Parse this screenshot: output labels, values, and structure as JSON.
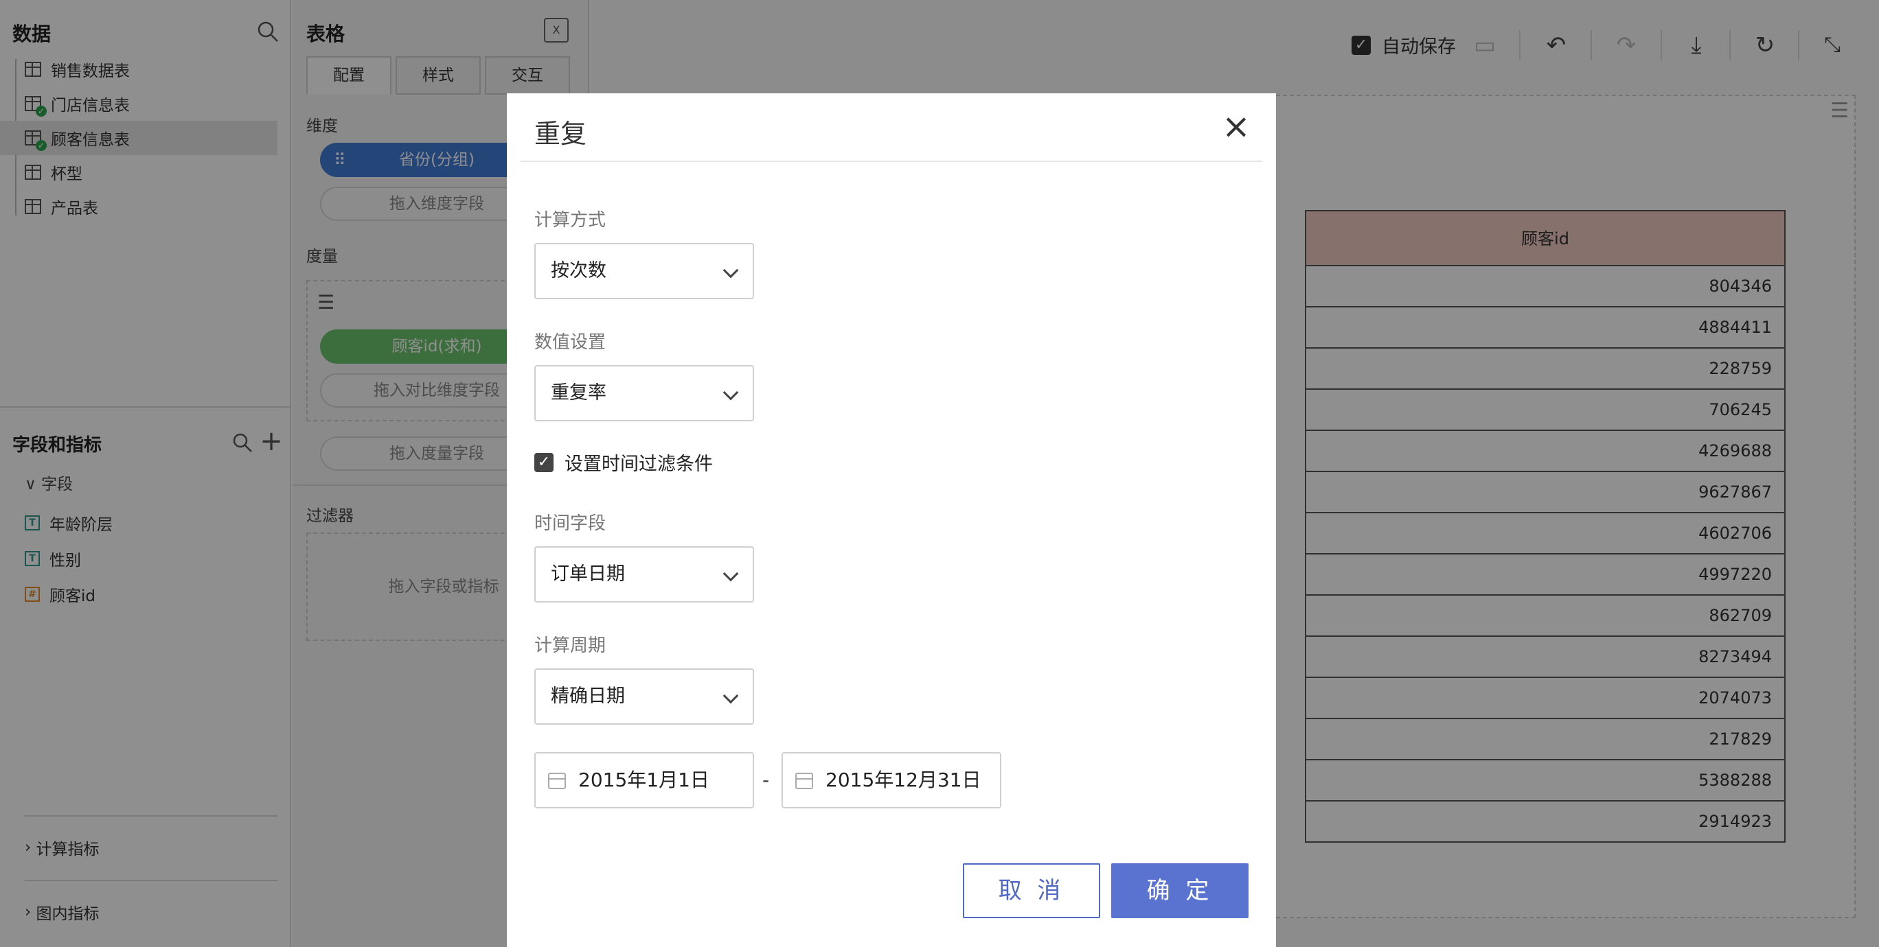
{
  "data_panel": {
    "title": "数据",
    "tables": [
      {
        "label": "销售数据表",
        "synced": false
      },
      {
        "label": "门店信息表",
        "synced": true
      },
      {
        "label": "顾客信息表",
        "synced": true
      },
      {
        "label": "杯型",
        "synced": false
      },
      {
        "label": "产品表",
        "synced": false
      }
    ],
    "fields_title": "字段和指标",
    "fields_group": "字段",
    "fields": [
      {
        "label": "年龄阶层",
        "type": "T"
      },
      {
        "label": "性别",
        "type": "T"
      },
      {
        "label": "顾客id",
        "type": "#"
      }
    ],
    "calc_metrics": "计算指标",
    "chart_metrics": "图内指标"
  },
  "config_panel": {
    "title": "表格",
    "tabs": [
      "配置",
      "样式",
      "交互"
    ],
    "dimension_label": "维度",
    "dimension_pill": "省份(分组)",
    "dimension_hint": "拖入维度字段",
    "measure_label": "度量",
    "measure_pill": "顾客id(求和)",
    "compare_hint": "拖入对比维度字段",
    "measure_hint": "拖入度量字段",
    "filter_label": "过滤器",
    "filter_hint": "拖入字段或指标"
  },
  "toolbar": {
    "autosave_label": "自动保存",
    "autosave_checked": true
  },
  "table": {
    "header": "顾客id",
    "rows": [
      "804346",
      "4884411",
      "228759",
      "706245",
      "4269688",
      "9627867",
      "4602706",
      "4997220",
      "862709",
      "8273494",
      "2074073",
      "217829",
      "5388288",
      "2914923"
    ]
  },
  "modal": {
    "title": "重复",
    "calc_method_label": "计算方式",
    "calc_method_value": "按次数",
    "value_setting_label": "数值设置",
    "value_setting_value": "重复率",
    "time_filter_label": "设置时间过滤条件",
    "time_filter_checked": true,
    "time_field_label": "时间字段",
    "time_field_value": "订单日期",
    "period_label": "计算周期",
    "period_value": "精确日期",
    "start_date": "2015年1月1日",
    "date_separator": "-",
    "end_date": "2015年12月31日",
    "cancel_label": "取 消",
    "ok_label": "确 定"
  },
  "colors": {
    "primary": "#5b73d0",
    "dimension_pill": "#3f7bd6",
    "measure_pill": "#6cc26c",
    "table_header": "#f1c9c0",
    "synced_badge": "#2ea44f"
  }
}
